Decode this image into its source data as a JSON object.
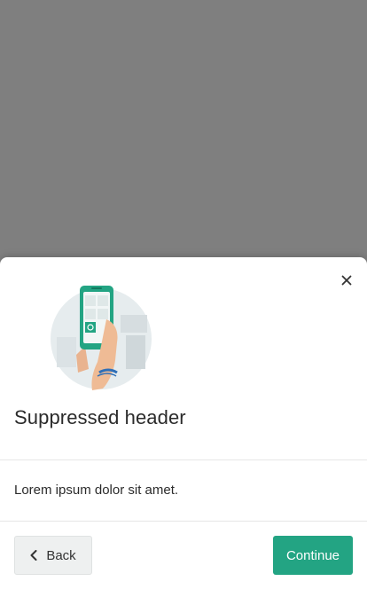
{
  "modal": {
    "title": "Suppressed header",
    "body": "Lorem ipsum dolor sit amet.",
    "illustration": "hand-holding-phone-illustration",
    "close_icon": "close-icon"
  },
  "footer": {
    "back_label": "Back",
    "back_icon": "chevron-left-icon",
    "continue_label": "Continue"
  },
  "colors": {
    "overlay": "#7f7f7f",
    "primary": "#23a483",
    "secondary_bg": "#eef0f0",
    "text": "#2b2b2b"
  }
}
